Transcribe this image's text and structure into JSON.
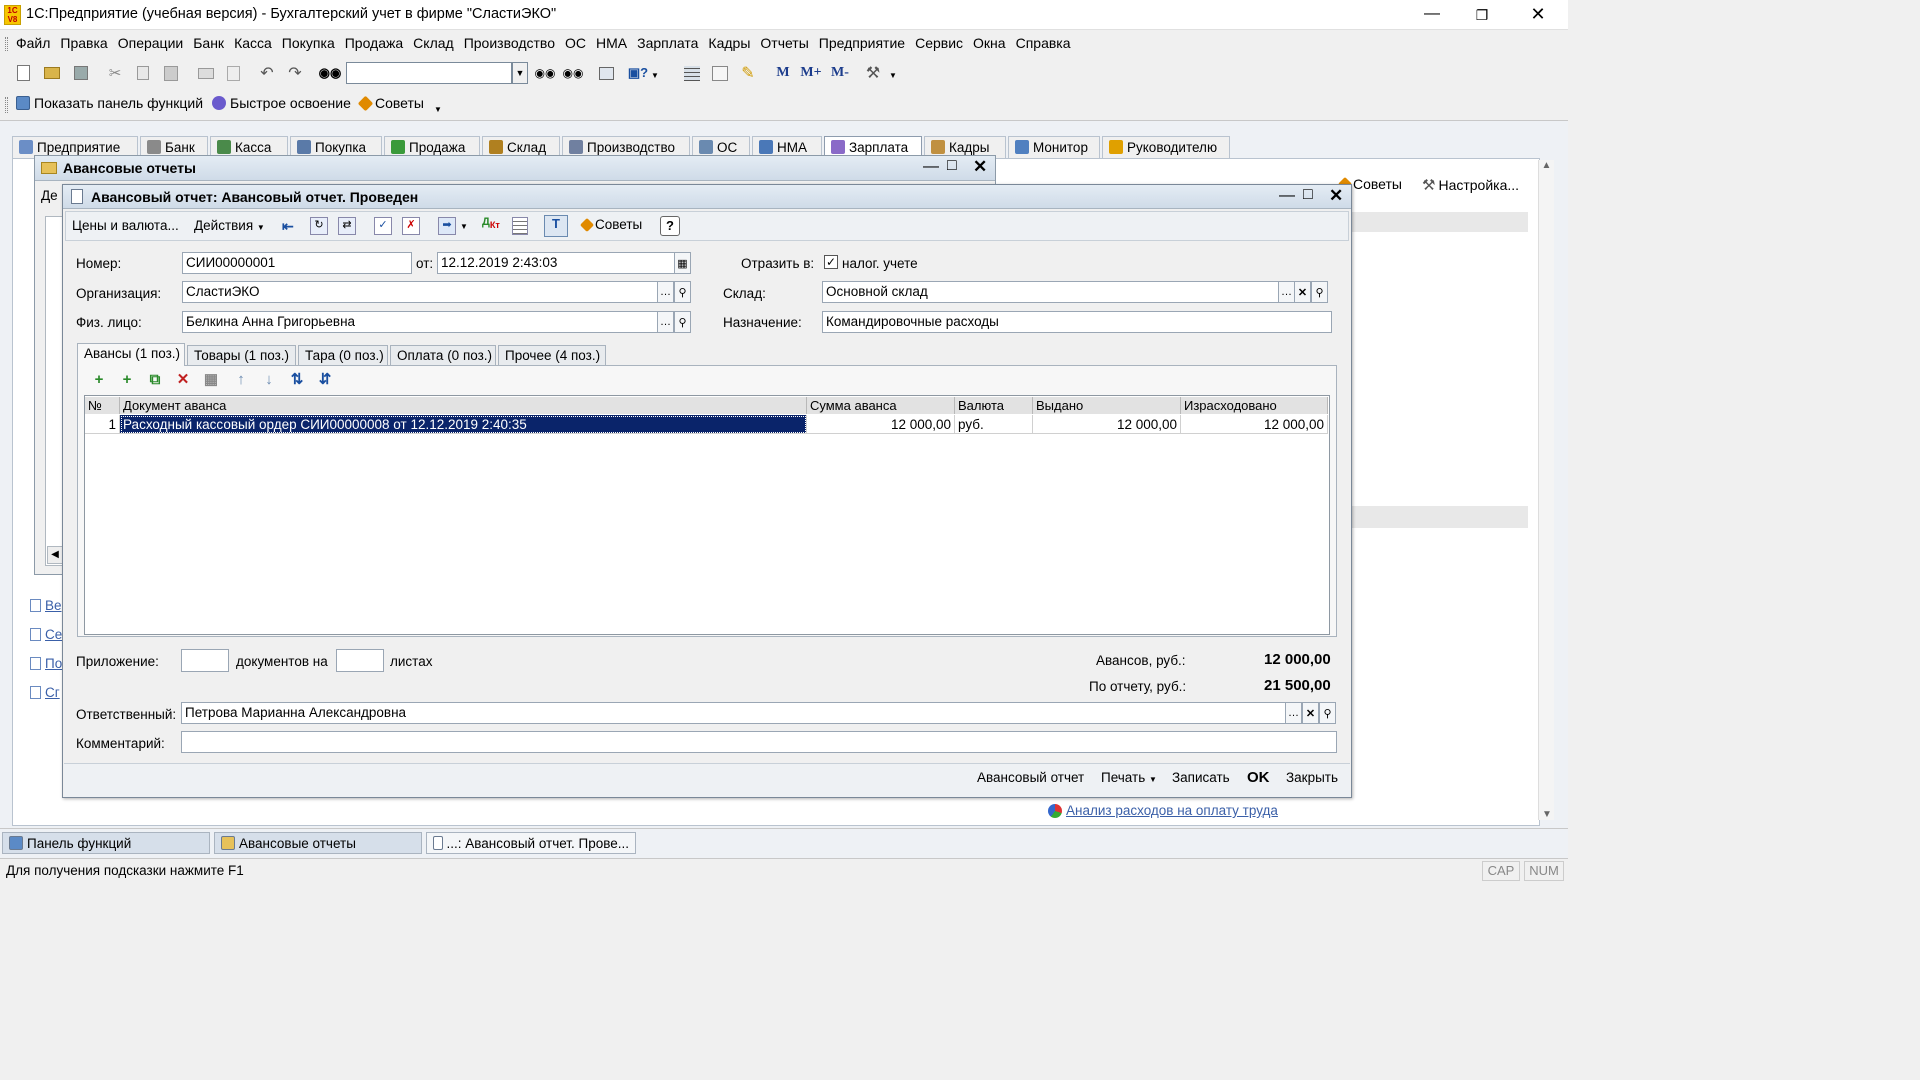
{
  "app": {
    "title": "1С:Предприятие (учебная версия) - Бухгалтерский учет в фирме \"СластиЭКО\"",
    "logo": "1С",
    "logo_sub": "V8"
  },
  "menu": [
    "Файл",
    "Правка",
    "Операции",
    "Банк",
    "Касса",
    "Покупка",
    "Продажа",
    "Склад",
    "Производство",
    "ОС",
    "НМА",
    "Зарплата",
    "Кадры",
    "Отчеты",
    "Предприятие",
    "Сервис",
    "Окна",
    "Справка"
  ],
  "toolbar2": {
    "show_panel": "Показать панель функций",
    "quick_learn": "Быстрое освоение",
    "tips": "Советы",
    "mem_m": "М",
    "mem_mplus": "М+",
    "mem_mminus": "М-"
  },
  "section_tabs": [
    "Предприятие",
    "Банк",
    "Касса",
    "Покупка",
    "Продажа",
    "Склад",
    "Производство",
    "ОС",
    "НМА",
    "Зарплата",
    "Кадры",
    "Монитор",
    "Руководителю"
  ],
  "bg_panel": {
    "tips": "Советы",
    "settings": "Настройка...",
    "link_bottom": "Анализ расходов на оплату труда",
    "side_links": [
      "Ве",
      "Се",
      "По",
      "Сг"
    ],
    "frag_label": "Де"
  },
  "list_window": {
    "title": "Авансовые отчеты"
  },
  "doc_window": {
    "title": "Авансовый отчет: Авансовый отчет. Проведен",
    "toolbar": {
      "prices": "Цены и валюта...",
      "actions": "Действия",
      "tips": "Советы",
      "help": "?"
    },
    "fields": {
      "number_label": "Номер:",
      "number": "СИИ00000001",
      "date_label": "от:",
      "date": "12.12.2019  2:43:03",
      "reflect_label": "Отразить в:",
      "tax_label": "налог. учете",
      "tax_checked": true,
      "org_label": "Организация:",
      "org": "СластиЭКО",
      "warehouse_label": "Склад:",
      "warehouse": "Основной склад",
      "person_label": "Физ. лицо:",
      "person": "Белкина Анна Григорьевна",
      "purpose_label": "Назначение:",
      "purpose": "Командировочные расходы"
    },
    "tabs": [
      "Авансы (1 поз.)",
      "Товары (1 поз.)",
      "Тара (0 поз.)",
      "Оплата (0 поз.)",
      "Прочее (4 поз.)"
    ],
    "table": {
      "columns": [
        "№",
        "Документ аванса",
        "Сумма аванса",
        "Валюта",
        "Выдано",
        "Израсходовано"
      ],
      "rows": [
        {
          "n": "1",
          "doc": "Расходный кассовый ордер СИИ00000008 от 12.12.2019 2:40:35",
          "sum": "12 000,00",
          "currency": "руб.",
          "issued": "12 000,00",
          "spent": "12 000,00"
        }
      ]
    },
    "footer": {
      "attach_label": "Приложение:",
      "docs_on": "документов на",
      "sheets": "листах",
      "advances_label": "Авансов, руб.:",
      "advances": "12 000,00",
      "by_report_label": "По отчету, руб.:",
      "by_report": "21 500,00",
      "responsible_label": "Ответственный:",
      "responsible": "Петрова Марианна Александровна",
      "comment_label": "Комментарий:",
      "comment": ""
    },
    "buttons": {
      "report": "Авансовый отчет",
      "print": "Печать",
      "save": "Записать",
      "ok": "OK",
      "close": "Закрыть"
    }
  },
  "taskbar": [
    "Панель функций",
    "Авансовые отчеты",
    "...: Авансовый отчет. Прове..."
  ],
  "status": {
    "hint": "Для получения подсказки нажмите F1",
    "cap": "CAP",
    "num": "NUM"
  },
  "colors": {
    "selection": "#0a246a",
    "accent": "#f0c000",
    "window_title": "#d8e4f0"
  }
}
